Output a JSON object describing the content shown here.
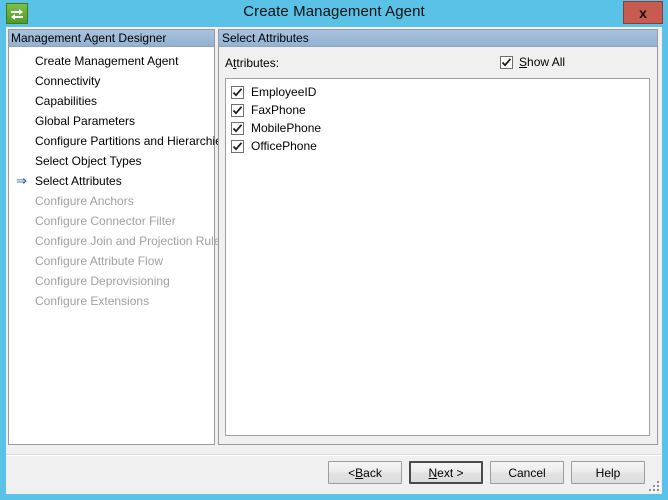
{
  "window": {
    "title": "Create Management Agent",
    "icon": "sync-arrows-icon",
    "close_label": "x",
    "frame_color": "#5bc2e7",
    "close_color": "#c75b51"
  },
  "nav_panel": {
    "header": "Management Agent Designer",
    "current_index": 6,
    "arrow_glyph": "⇒",
    "items": [
      {
        "label": "Create Management Agent",
        "enabled": true,
        "current": false
      },
      {
        "label": "Connectivity",
        "enabled": true,
        "current": false
      },
      {
        "label": "Capabilities",
        "enabled": true,
        "current": false
      },
      {
        "label": "Global Parameters",
        "enabled": true,
        "current": false
      },
      {
        "label": "Configure Partitions and Hierarchies",
        "enabled": true,
        "current": false
      },
      {
        "label": "Select Object Types",
        "enabled": true,
        "current": false
      },
      {
        "label": "Select Attributes",
        "enabled": true,
        "current": true
      },
      {
        "label": "Configure Anchors",
        "enabled": false,
        "current": false
      },
      {
        "label": "Configure Connector Filter",
        "enabled": false,
        "current": false
      },
      {
        "label": "Configure Join and Projection Rules",
        "enabled": false,
        "current": false
      },
      {
        "label": "Configure Attribute Flow",
        "enabled": false,
        "current": false
      },
      {
        "label": "Configure Deprovisioning",
        "enabled": false,
        "current": false
      },
      {
        "label": "Configure Extensions",
        "enabled": false,
        "current": false
      }
    ]
  },
  "content_panel": {
    "header": "Select Attributes",
    "attributes_label_pre": "A",
    "attributes_label_mnemonic": "t",
    "attributes_label_post": "tributes:",
    "show_all": {
      "label_mnemonic": "S",
      "label_post": "how All",
      "checked": true
    },
    "attributes": [
      {
        "name": "EmployeeID",
        "checked": true
      },
      {
        "name": "FaxPhone",
        "checked": true
      },
      {
        "name": "MobilePhone",
        "checked": true
      },
      {
        "name": "OfficePhone",
        "checked": true
      }
    ]
  },
  "buttons": {
    "back": {
      "pre": "< ",
      "mnemonic": "B",
      "post": "ack"
    },
    "next": {
      "pre": "",
      "mnemonic": "N",
      "post": "ext >",
      "default": true
    },
    "cancel": {
      "label": "Cancel"
    },
    "help": {
      "label": "Help"
    }
  }
}
